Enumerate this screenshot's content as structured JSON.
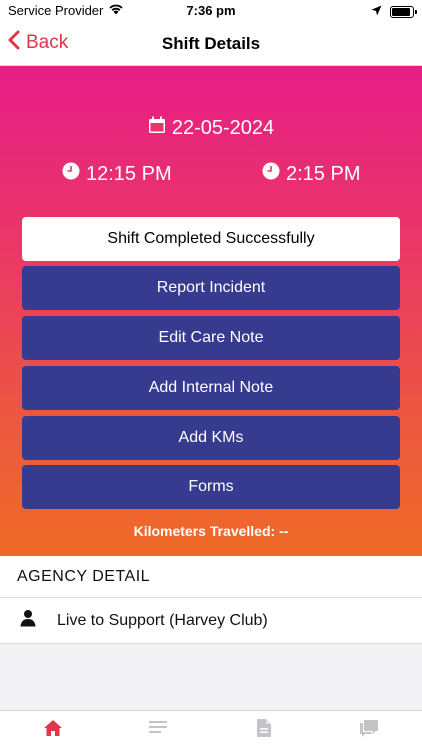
{
  "status_bar": {
    "carrier": "Service Provider",
    "time": "7:36 pm",
    "battery_level": 0.9
  },
  "nav": {
    "back_label": "Back",
    "title": "Shift Details"
  },
  "shift": {
    "date": "22-05-2024",
    "start_time": "12:15 PM",
    "end_time": "2:15 PM",
    "status_label": "Shift Completed Successfully",
    "actions": [
      "Report Incident",
      "Edit Care Note",
      "Add Internal Note",
      "Add KMs",
      "Forms"
    ],
    "kilometers_text": "Kilometers Travelled: --"
  },
  "agency": {
    "header": "AGENCY DETAIL",
    "name": "Live to Support (Harvey Club)"
  },
  "tabs": {
    "active": "home-icon",
    "icons": [
      "home-icon",
      "list-icon",
      "document-icon",
      "chat-icon"
    ]
  },
  "colors": {
    "accent": "#e0364a",
    "button_blue": "#363b8f",
    "gradient_top": "#e71d86",
    "gradient_bottom": "#ee6a27"
  }
}
